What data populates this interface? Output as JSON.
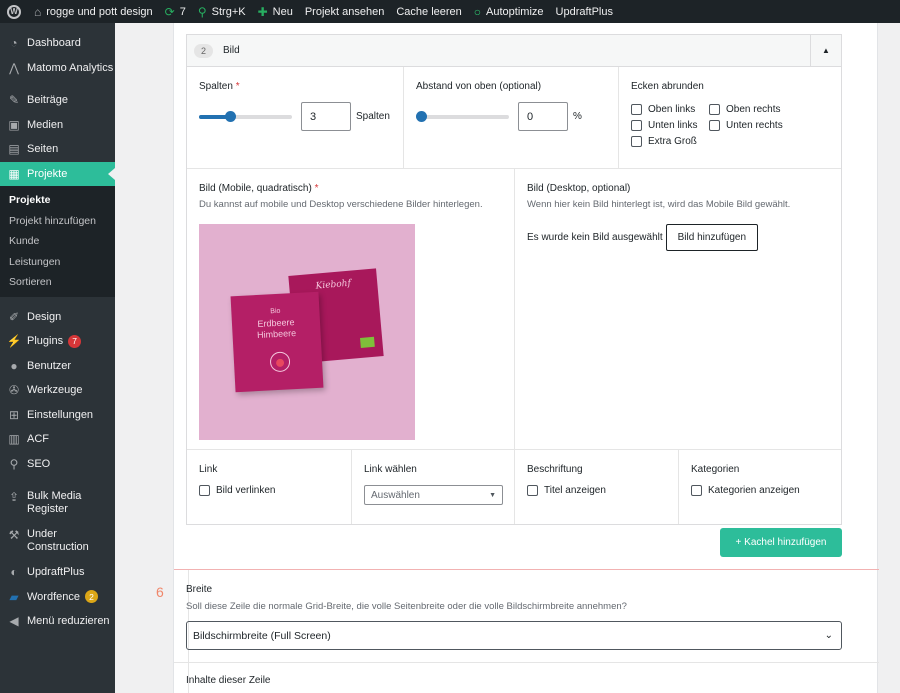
{
  "adminbar": {
    "site_name": "rogge und pott design",
    "updates_count": "7",
    "search_shortcut": "Strg+K",
    "new_label": "Neu",
    "view_project": "Projekt ansehen",
    "clear_cache": "Cache leeren",
    "autoptimize": "Autoptimize",
    "updraftplus": "UpdraftPlus"
  },
  "sidebar": {
    "dashboard": "Dashboard",
    "matomo": "Matomo Analytics",
    "posts": "Beiträge",
    "media": "Medien",
    "pages": "Seiten",
    "projects": "Projekte",
    "submenu": [
      "Projekte",
      "Projekt hinzufügen",
      "Kunde",
      "Leistungen",
      "Sortieren"
    ],
    "design": "Design",
    "plugins": "Plugins",
    "plugins_badge": "7",
    "users": "Benutzer",
    "tools": "Werkzeuge",
    "settings": "Einstellungen",
    "acf": "ACF",
    "seo": "SEO",
    "bulk_media": "Bulk Media Register",
    "under_construction": "Under Construction",
    "updraftplus": "UpdraftPlus",
    "wordfence": "Wordfence",
    "wordfence_badge": "2",
    "collapse": "Menü reduzieren"
  },
  "layout": {
    "order": "2",
    "title": "Bild",
    "columns_label": "Spalten",
    "required_mark": "*",
    "columns_value": "3",
    "columns_fraction": 0.33,
    "columns_unit": "Spalten",
    "top_spacing_label": "Abstand von oben (optional)",
    "top_spacing_value": "0",
    "top_spacing_fraction": 0.0,
    "top_spacing_unit": "%",
    "corners_label": "Ecken abrunden",
    "corners": [
      "Oben links",
      "Oben rechts",
      "Unten links",
      "Unten rechts",
      "Extra Groß"
    ],
    "mobile_image_label": "Bild (Mobile, quadratisch)",
    "mobile_image_desc": "Du kannst auf mobile und Desktop verschiedene Bilder hinterlegen.",
    "pack_front_lines": [
      "Bio",
      "Erdbeere",
      "Himbeere"
    ],
    "pack_back_brand": "Kiebohf",
    "desktop_image_label": "Bild (Desktop, optional)",
    "desktop_image_desc": "Wenn hier kein Bild hinterlegt ist, wird das Mobile Bild gewählt.",
    "no_image_text": "Es wurde kein Bild ausgewählt",
    "add_image_button": "Bild hinzufügen",
    "link_label": "Link",
    "link_checkbox": "Bild verlinken",
    "link_select_label": "Link wählen",
    "link_select_placeholder": "Auswählen",
    "caption_label": "Beschriftung",
    "caption_checkbox": "Titel anzeigen",
    "categories_label": "Kategorien",
    "categories_checkbox": "Kategorien anzeigen"
  },
  "add_tile_button": "+ Kachel hinzufügen",
  "row6": {
    "number": "6",
    "width_label": "Breite",
    "width_desc": "Soll diese Zeile die normale Grid-Breite, die volle Seitenbreite oder die volle Bildschirmbreite annehmen?",
    "width_value": "Bildschirmbreite (Full Screen)",
    "content_label": "Inhalte dieser Zeile"
  }
}
